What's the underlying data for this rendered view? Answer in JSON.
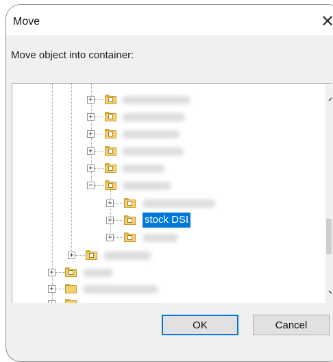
{
  "window": {
    "title": "Move"
  },
  "prompt": "Move object into container:",
  "tree": {
    "selected_label": "stock DSI"
  },
  "buttons": {
    "ok": "OK",
    "cancel": "Cancel"
  },
  "colors": {
    "selection": "#0078d7",
    "default_button_border": "#0078d7"
  },
  "icons": {
    "close": "close-icon",
    "expand": "plus-expander-icon",
    "collapse": "minus-expander-icon",
    "container": "folder-icon"
  }
}
